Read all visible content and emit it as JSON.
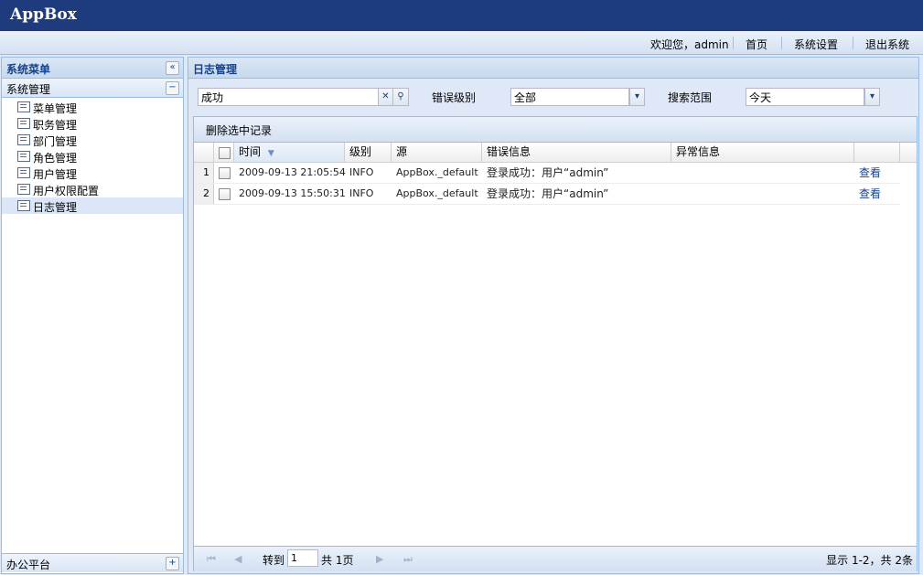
{
  "app": {
    "title": "AppBox"
  },
  "topbar": {
    "welcome": "欢迎您，admin",
    "links": [
      "首页",
      "系统设置",
      "退出系统"
    ]
  },
  "sidebar": {
    "title": "系统菜单",
    "collapse_icon": "double-chevron-left-icon",
    "group_title": "系统管理",
    "group_collapse_icon": "minus-icon",
    "items": [
      {
        "label": "菜单管理"
      },
      {
        "label": "职务管理"
      },
      {
        "label": "部门管理"
      },
      {
        "label": "角色管理"
      },
      {
        "label": "用户管理"
      },
      {
        "label": "用户权限配置"
      },
      {
        "label": "日志管理",
        "selected": true
      }
    ],
    "bottom_group_title": "办公平台",
    "bottom_group_expand_icon": "plus-icon"
  },
  "main": {
    "title": "日志管理",
    "search": {
      "value": "成功",
      "clear_icon": "clear-x-icon",
      "search_icon": "search-icon"
    },
    "level_label": "错误级别",
    "level_value": "全部",
    "range_label": "搜索范围",
    "range_value": "今天"
  },
  "grid": {
    "toolbar_button": "删除选中记录",
    "columns": [
      "时间",
      "级别",
      "源",
      "错误信息",
      "异常信息"
    ],
    "sort_icon": "sort-down-arrow-icon",
    "rows": [
      {
        "n": "1",
        "time": "2009-09-13 21:05:54",
        "level": "INFO",
        "source": "AppBox._default",
        "message": "登录成功：用户“admin”",
        "action": "查看"
      },
      {
        "n": "2",
        "time": "2009-09-13 15:50:31",
        "level": "INFO",
        "source": "AppBox._default",
        "message": "登录成功：用户“admin”",
        "action": "查看"
      }
    ],
    "paging": {
      "goto_label": "转到",
      "page_value": "1",
      "total_pages": "共 1页",
      "summary": "显示 1-2，共 2条"
    }
  },
  "colors": {
    "banner": "#1e3c7d",
    "header_text": "#15428b",
    "link": "#15428b"
  }
}
